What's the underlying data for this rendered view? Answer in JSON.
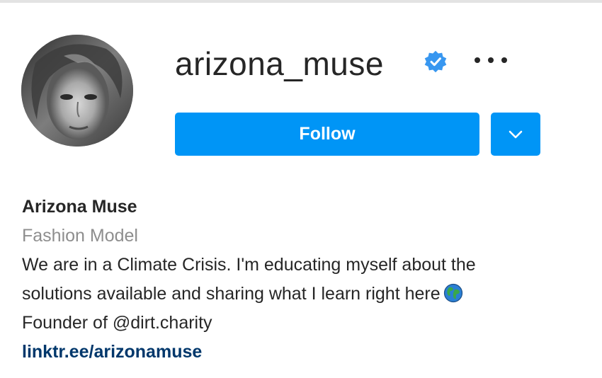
{
  "profile": {
    "username": "arizona_muse",
    "follow_label": "Follow",
    "full_name": "Arizona Muse",
    "category": "Fashion Model",
    "bio_line_1": "We are in a Climate Crisis. I'm educating myself about the",
    "bio_line_2": "solutions available and sharing what I learn right here",
    "bio_line_3": "Founder of @dirt.charity",
    "link": "linktr.ee/arizonamuse"
  },
  "colors": {
    "accent": "#0095f6",
    "verified": "#3897f0",
    "text": "#262626",
    "muted": "#8e8e8e",
    "link": "#00376b"
  },
  "icons": {
    "verified": "verified-badge-icon",
    "more": "more-options-icon",
    "dropdown": "chevron-down-icon",
    "globe": "globe-emoji-icon"
  }
}
